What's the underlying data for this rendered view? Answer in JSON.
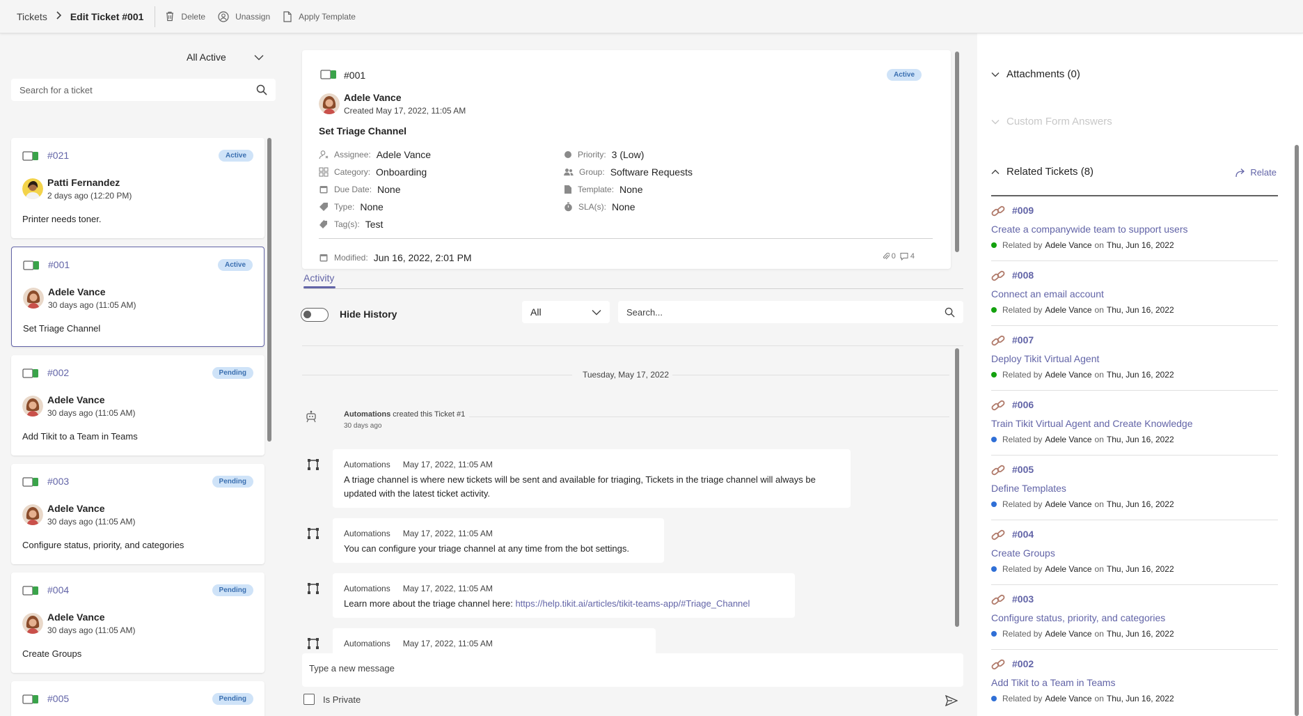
{
  "breadcrumb": {
    "root": "Tickets",
    "current": "Edit Ticket #001"
  },
  "toolbar": {
    "delete": "Delete",
    "unassign": "Unassign",
    "apply_template": "Apply Template"
  },
  "list": {
    "filter": "All Active",
    "search_placeholder": "Search for a ticket",
    "tickets": [
      {
        "id": "#021",
        "status": "Active",
        "name": "Patti Fernandez",
        "time": "2 days ago (12:20 PM)",
        "title": "Printer needs toner."
      },
      {
        "id": "#001",
        "status": "Active",
        "name": "Adele Vance",
        "time": "30 days ago (11:05 AM)",
        "title": "Set Triage Channel"
      },
      {
        "id": "#002",
        "status": "Pending",
        "name": "Adele Vance",
        "time": "30 days ago (11:05 AM)",
        "title": "Add Tikit to a Team in Teams"
      },
      {
        "id": "#003",
        "status": "Pending",
        "name": "Adele Vance",
        "time": "30 days ago (11:05 AM)",
        "title": "Configure status, priority, and categories"
      },
      {
        "id": "#004",
        "status": "Pending",
        "name": "Adele Vance",
        "time": "30 days ago (11:05 AM)",
        "title": "Create Groups"
      },
      {
        "id": "#005",
        "status": "Pending",
        "name": "",
        "time": "",
        "title": ""
      }
    ]
  },
  "ticket": {
    "id": "#001",
    "status": "Active",
    "requester": "Adele Vance",
    "created": "Created May 17, 2022, 11:05 AM",
    "title": "Set Triage Channel",
    "fields": {
      "assignee_label": "Assignee:",
      "assignee": "Adele Vance",
      "category_label": "Category:",
      "category": "Onboarding",
      "due_label": "Due Date:",
      "due": "None",
      "type_label": "Type:",
      "type": "None",
      "tags_label": "Tag(s):",
      "tags": "Test",
      "priority_label": "Priority:",
      "priority": "3 (Low)",
      "group_label": "Group:",
      "group": "Software Requests",
      "template_label": "Template:",
      "template": "None",
      "sla_label": "SLA(s):",
      "sla": "None"
    },
    "modified_label": "Modified:",
    "modified": "Jun 16, 2022, 2:01 PM",
    "attachments_count": "0",
    "comments_count": "4"
  },
  "activity": {
    "tab": "Activity",
    "hide_history": "Hide History",
    "filter": "All",
    "search_placeholder": "Search...",
    "date": "Tuesday, May 17, 2022",
    "system_event": {
      "actor": "Automations",
      "text": "created this Ticket #1",
      "when": "30 days ago"
    },
    "messages": [
      {
        "author": "Automations",
        "time": "May 17, 2022, 11:05 AM",
        "text": "A triage channel is where new tickets will be sent and available for triaging, Tickets in the triage channel will always be updated with the latest ticket activity."
      },
      {
        "author": "Automations",
        "time": "May 17, 2022, 11:05 AM",
        "text": "You can configure your triage channel at any time from the bot settings."
      },
      {
        "author": "Automations",
        "time": "May 17, 2022, 11:05 AM",
        "text": "Learn more about the triage channel here: ",
        "link": "https://help.tikit.ai/articles/tikit-teams-app/#Triage_Channel"
      },
      {
        "author": "Automations",
        "time": "May 17, 2022, 11:05 AM",
        "text": ""
      }
    ],
    "composer_placeholder": "Type a new message",
    "private_label": "Is Private"
  },
  "right": {
    "attachments": "Attachments (0)",
    "custom_form": "Custom Form Answers",
    "related": "Related Tickets (8)",
    "relate": "Relate",
    "related_by_label": "Related by",
    "on_label": "on",
    "items": [
      {
        "id": "#009",
        "title": "Create a companywide team to support users",
        "by": "Adele Vance",
        "date": "Thu, Jun 16, 2022",
        "dot": "#13a10e"
      },
      {
        "id": "#008",
        "title": "Connect an email account",
        "by": "Adele Vance",
        "date": "Thu, Jun 16, 2022",
        "dot": "#13a10e"
      },
      {
        "id": "#007",
        "title": "Deploy Tikit Virtual Agent",
        "by": "Adele Vance",
        "date": "Thu, Jun 16, 2022",
        "dot": "#13a10e"
      },
      {
        "id": "#006",
        "title": "Train Tikit Virtual Agent and Create Knowledge",
        "by": "Adele Vance",
        "date": "Thu, Jun 16, 2022",
        "dot": "#2f6fd6"
      },
      {
        "id": "#005",
        "title": "Define Templates",
        "by": "Adele Vance",
        "date": "Thu, Jun 16, 2022",
        "dot": "#2f6fd6"
      },
      {
        "id": "#004",
        "title": "Create Groups",
        "by": "Adele Vance",
        "date": "Thu, Jun 16, 2022",
        "dot": "#2f6fd6"
      },
      {
        "id": "#003",
        "title": "Configure status, priority, and categories",
        "by": "Adele Vance",
        "date": "Thu, Jun 16, 2022",
        "dot": "#2f6fd6"
      },
      {
        "id": "#002",
        "title": "Add Tikit to a Team in Teams",
        "by": "Adele Vance",
        "date": "Thu, Jun 16, 2022",
        "dot": "#2f6fd6"
      }
    ]
  }
}
